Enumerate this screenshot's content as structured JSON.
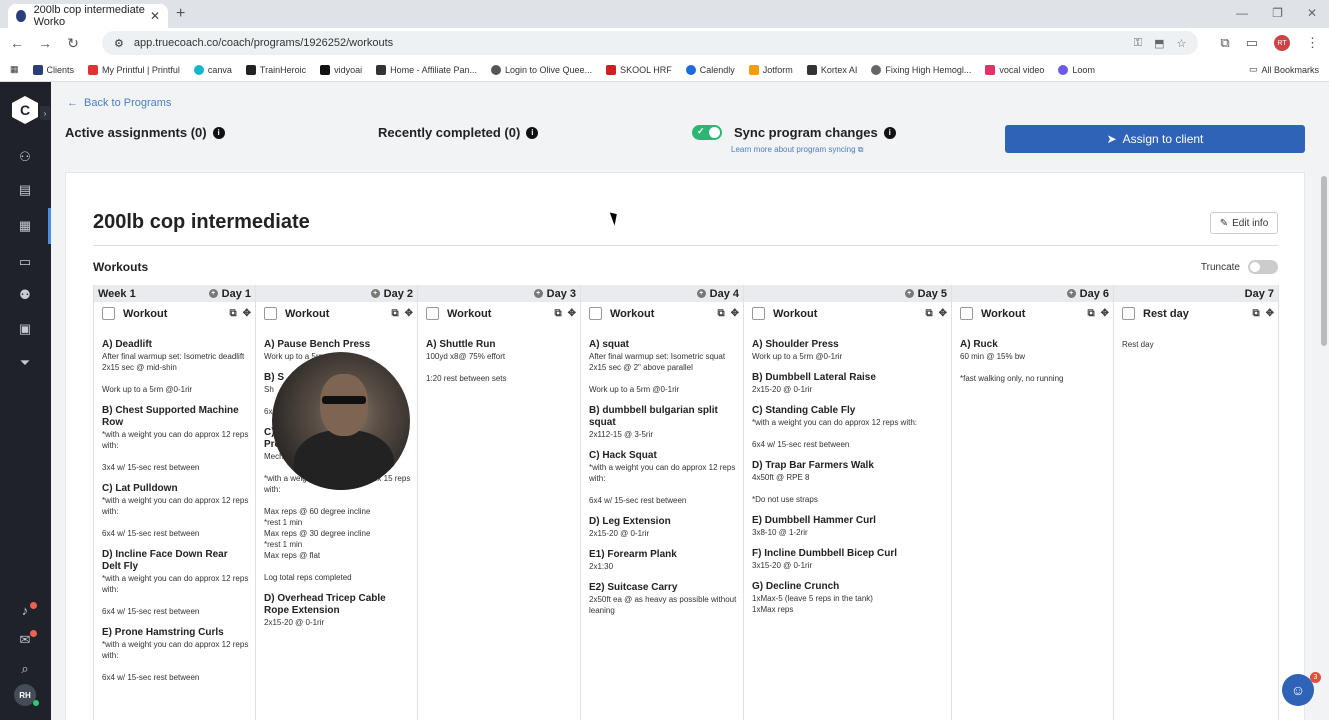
{
  "browser": {
    "tab_title": "200lb cop intermediate Worko",
    "url": "app.truecoach.co/coach/programs/1926252/workouts",
    "bookmarks": [
      "Clients",
      "My Printful | Printful",
      "canva",
      "TrainHeroic",
      "vidyoai",
      "Home - Affiliate Pan...",
      "Login to Olive Quee...",
      "SKOOL HRF",
      "Calendly",
      "Jotform",
      "Kortex AI",
      "Fixing High Hemogl...",
      "vocal video",
      "Loom"
    ],
    "all_bookmarks": "All Bookmarks",
    "profile_initials": "RT"
  },
  "sidebar": {
    "user_initials": "RH"
  },
  "header": {
    "back_label": "Back to Programs",
    "active_assignments": "Active assignments (0)",
    "recently_completed": "Recently completed (0)",
    "sync_label": "Sync program changes",
    "learn_more": "Learn more about program syncing",
    "assign_label": "Assign to client"
  },
  "program": {
    "title": "200lb cop intermediate",
    "edit_label": "Edit info",
    "workouts_label": "Workouts",
    "truncate_label": "Truncate",
    "week_label": "Week 1"
  },
  "days": [
    {
      "label": "Day 1",
      "title": "Workout",
      "exercises": [
        {
          "n": "A) Deadlift",
          "d": "After final warmup set: Isometric deadlift 2x15 sec @ mid-shin\n\nWork up to a 5rm @0-1rir"
        },
        {
          "n": "B) Chest Supported Machine Row",
          "d": "*with a weight you can do approx 12 reps with:\n\n3x4 w/ 15-sec rest between"
        },
        {
          "n": "C) Lat Pulldown",
          "d": "*with a weight you can do approx 12 reps with:\n\n6x4 w/ 15-sec rest between"
        },
        {
          "n": "D) Incline Face Down Rear Delt Fly",
          "d": "*with a weight you can do approx 12 reps with:\n\n6x4 w/ 15-sec rest between"
        },
        {
          "n": "E) Prone Hamstring Curls",
          "d": "*with a weight you can do approx 12 reps with:\n\n6x4 w/ 15-sec rest between"
        }
      ]
    },
    {
      "label": "Day 2",
      "title": "Workout",
      "exercises": [
        {
          "n": "A) Pause Bench Press",
          "d": "Work up to a 5rm"
        },
        {
          "n": "B) S",
          "d": "Sh\n\n6x"
        },
        {
          "n": "C) Inc\nPress",
          "d": "Mechanical advantage drop set:\n\n*with a weight you can do approx 15 reps with:\n\nMax reps @ 60 degree incline\n*rest 1 min\nMax reps @ 30 degree incline\n*rest 1 min\nMax reps @ flat\n\nLog total reps completed"
        },
        {
          "n": "D) Overhead Tricep Cable Rope Extension",
          "d": "2x15-20 @ 0-1rir"
        }
      ]
    },
    {
      "label": "Day 3",
      "title": "Workout",
      "exercises": [
        {
          "n": "A) Shuttle Run",
          "d": "100yd x8@ 75% effort\n\n1:20 rest between sets"
        }
      ]
    },
    {
      "label": "Day 4",
      "title": "Workout",
      "exercises": [
        {
          "n": "A) squat",
          "d": "After final warmup set: Isometric squat 2x15 sec @ 2\" above parallel\n\nWork up to a 5rm @0-1rir"
        },
        {
          "n": "B) dumbbell bulgarian split squat",
          "d": "2x112-15 @ 3-5rir"
        },
        {
          "n": "C) Hack Squat",
          "d": "*with a weight you can do approx 12 reps with:\n\n6x4 w/ 15-sec rest between"
        },
        {
          "n": "D) Leg Extension",
          "d": "2x15-20 @ 0-1rir"
        },
        {
          "n": "E1) Forearm Plank",
          "d": "2x1:30"
        },
        {
          "n": "E2) Suitcase Carry",
          "d": "2x50ft ea @ as heavy as possible without leaning"
        }
      ]
    },
    {
      "label": "Day 5",
      "title": "Workout",
      "exercises": [
        {
          "n": "A) Shoulder Press",
          "d": "Work up to a 5rm @0-1rir"
        },
        {
          "n": "B) Dumbbell Lateral Raise",
          "d": "2x15-20 @ 0-1rir"
        },
        {
          "n": "C) Standing Cable Fly",
          "d": "*with a weight you can do approx 12 reps with:\n\n6x4 w/ 15-sec rest between"
        },
        {
          "n": "D) Trap Bar Farmers Walk",
          "d": "4x50ft @ RPE 8\n\n*Do not use straps"
        },
        {
          "n": "E) Dumbbell Hammer Curl",
          "d": "3x8-10 @ 1-2rir"
        },
        {
          "n": "F) Incline Dumbbell Bicep Curl",
          "d": "3x15-20 @ 0-1rir"
        },
        {
          "n": "G) Decline Crunch",
          "d": "1xMax-5 (leave 5 reps in the tank)\n1xMax reps"
        }
      ]
    },
    {
      "label": "Day 6",
      "title": "Workout",
      "exercises": [
        {
          "n": "A) Ruck",
          "d": "60 min @ 15% bw\n\n*fast walking only, no running"
        }
      ]
    },
    {
      "label": "Day 7",
      "title": "Rest day",
      "exercises": [
        {
          "n": "",
          "d": "Rest day"
        }
      ]
    }
  ],
  "chat": {
    "badge": "3"
  },
  "colors": {
    "accent": "#2f63b8",
    "sidebar": "#1f2329",
    "toggle_on": "#2bb673"
  }
}
